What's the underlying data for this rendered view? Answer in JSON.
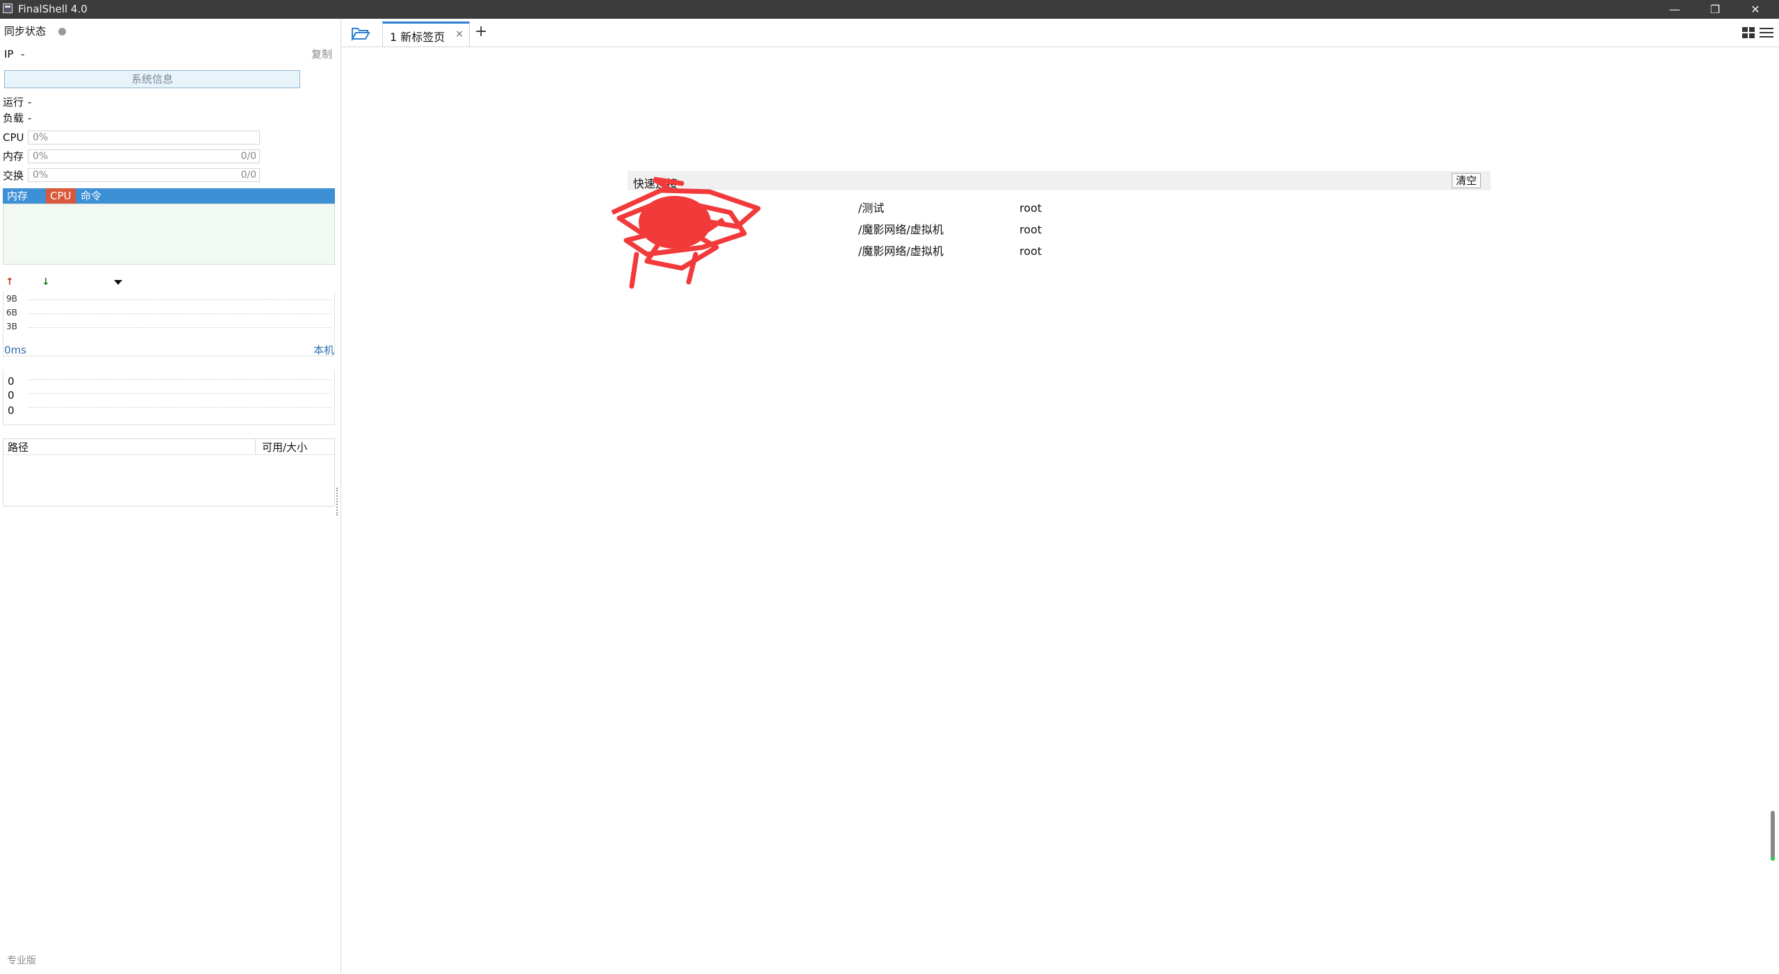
{
  "window": {
    "title": "FinalShell 4.0",
    "minimize": "—",
    "restore": "❐",
    "close": "✕"
  },
  "sidebar": {
    "sync_label": "同步状态",
    "ip_label": "IP",
    "ip_value": "-",
    "copy_label": "复制",
    "sysinfo_button": "系统信息",
    "uptime_label": "运行",
    "uptime_value": "-",
    "load_label": "负载",
    "load_value": "-",
    "cpu": {
      "label": "CPU",
      "percent": "0%"
    },
    "memory": {
      "label": "内存",
      "percent": "0%",
      "usage": "0/0"
    },
    "swap": {
      "label": "交换",
      "percent": "0%",
      "usage": "0/0"
    },
    "process_tabs": [
      "内存",
      "CPU",
      "命令"
    ],
    "network": {
      "y_ticks": [
        "9B",
        "6B",
        "3B"
      ]
    },
    "ping": {
      "latency": "0ms",
      "target": "本机",
      "values": [
        "0",
        "0",
        "0"
      ]
    },
    "disk": {
      "columns": [
        "路径",
        "可用/大小"
      ]
    },
    "edition": "专业版"
  },
  "tabs": [
    {
      "label": "1 新标签页",
      "close": "×"
    }
  ],
  "add_tab": "+",
  "quick_connect": {
    "title": "快速连接",
    "clear_button": "清空",
    "rows": [
      {
        "path": "/测试",
        "user": "root"
      },
      {
        "path": "/魔影网络/虚拟机",
        "user": "root"
      },
      {
        "path": "/魔影网络/虚拟机",
        "user": "root"
      }
    ]
  },
  "colors": {
    "titlebar": "#3c3c3c",
    "process_header": "#3d8fd6",
    "cpu_tab": "#d9573a",
    "accent": "#2f7fd0",
    "redaction": "#f23a3a"
  }
}
